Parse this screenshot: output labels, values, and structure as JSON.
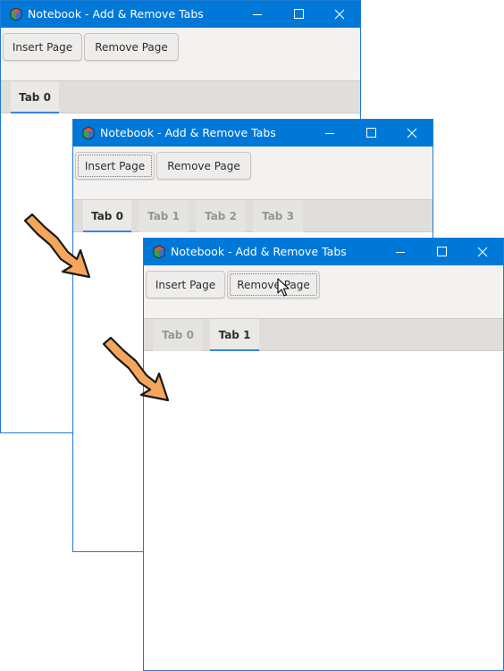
{
  "windows": [
    {
      "title": "Notebook - Add & Remove Tabs",
      "toolbar": {
        "insert_label": "Insert Page",
        "remove_label": "Remove Page"
      },
      "tabs": [
        {
          "label": "Tab 0",
          "active": true
        }
      ]
    },
    {
      "title": "Notebook - Add & Remove Tabs",
      "toolbar": {
        "insert_label": "Insert Page",
        "remove_label": "Remove Page"
      },
      "tabs": [
        {
          "label": "Tab 0",
          "active": true
        },
        {
          "label": "Tab 1",
          "active": false
        },
        {
          "label": "Tab 2",
          "active": false
        },
        {
          "label": "Tab 3",
          "active": false
        }
      ]
    },
    {
      "title": "Notebook - Add & Remove Tabs",
      "toolbar": {
        "insert_label": "Insert Page",
        "remove_label": "Remove Page"
      },
      "tabs": [
        {
          "label": "Tab 0",
          "active": false
        },
        {
          "label": "Tab 1",
          "active": true
        }
      ]
    }
  ],
  "colors": {
    "titlebar": "#0078d7",
    "tab_indicator": "#3584e4",
    "arrow_fill": "#f5a65b",
    "arrow_outline": "#1a1a1a"
  },
  "icons": [
    "app-cube-icon",
    "minimize-icon",
    "maximize-icon",
    "close-icon",
    "step-arrow-icon",
    "mouse-cursor-icon"
  ]
}
